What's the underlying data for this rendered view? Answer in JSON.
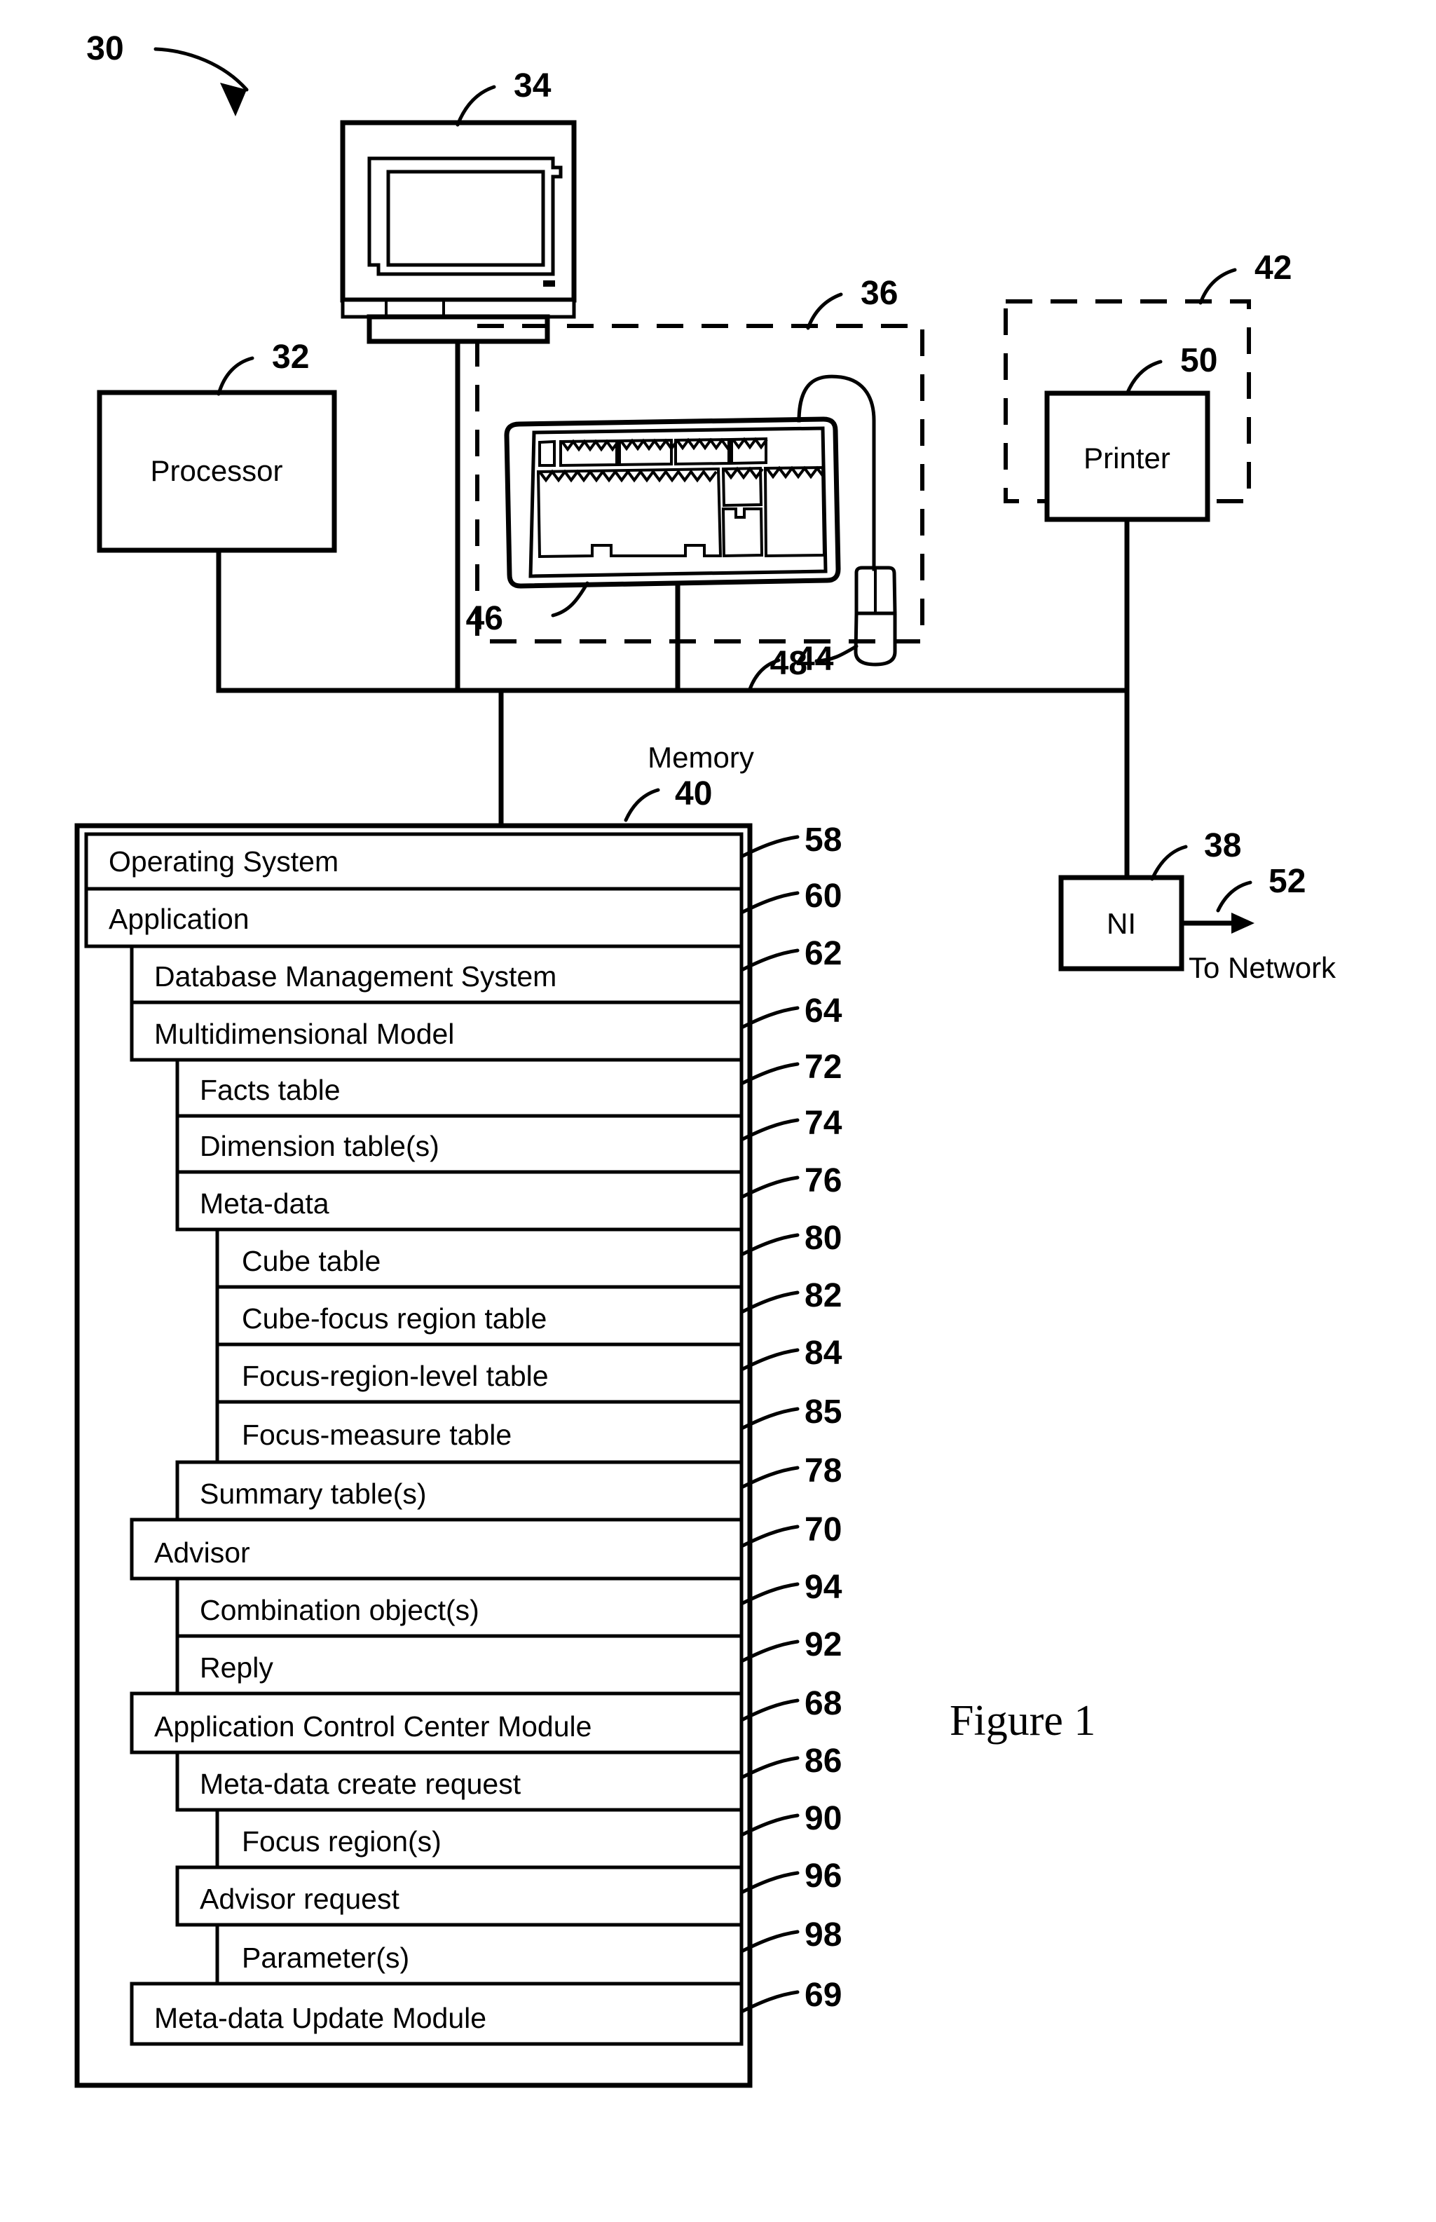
{
  "figure": {
    "caption": "Figure 1",
    "system_ref": "30"
  },
  "components": {
    "monitor": {
      "ref": "34",
      "name": "monitor"
    },
    "processor": {
      "label": "Processor",
      "ref": "32"
    },
    "io_group": {
      "ref": "36"
    },
    "keyboard": {
      "ref": "46",
      "name": "keyboard"
    },
    "mouse": {
      "ref": "48",
      "name": "mouse"
    },
    "printer_group": {
      "ref": "42"
    },
    "printer": {
      "label": "Printer",
      "ref": "50"
    },
    "network_interface": {
      "label": "NI",
      "ref": "38"
    },
    "network_arrow": {
      "label": "To Network",
      "ref": "52"
    },
    "bus": {
      "ref": "44"
    },
    "memory": {
      "label": "Memory",
      "ref": "40"
    }
  },
  "memory_rows": [
    {
      "label": "Operating System",
      "ref": "58",
      "indent": 0
    },
    {
      "label": "Application",
      "ref": "60",
      "indent": 0
    },
    {
      "label": "Database Management System",
      "ref": "62",
      "indent": 1
    },
    {
      "label": "Multidimensional Model",
      "ref": "64",
      "indent": 1
    },
    {
      "label": "Facts table",
      "ref": "72",
      "indent": 2
    },
    {
      "label": "Dimension table(s)",
      "ref": "74",
      "indent": 2
    },
    {
      "label": "Meta-data",
      "ref": "76",
      "indent": 2
    },
    {
      "label": "Cube table",
      "ref": "80",
      "indent": 3
    },
    {
      "label": "Cube-focus region table",
      "ref": "82",
      "indent": 3
    },
    {
      "label": "Focus-region-level table",
      "ref": "84",
      "indent": 3
    },
    {
      "label": "Focus-measure table",
      "ref": "85",
      "indent": 3
    },
    {
      "label": "Summary table(s)",
      "ref": "78",
      "indent": 2
    },
    {
      "label": "Advisor",
      "ref": "70",
      "indent": 1
    },
    {
      "label": "Combination object(s)",
      "ref": "94",
      "indent": 2
    },
    {
      "label": "Reply",
      "ref": "92",
      "indent": 2
    },
    {
      "label": "Application Control Center Module",
      "ref": "68",
      "indent": 1
    },
    {
      "label": "Meta-data create request",
      "ref": "86",
      "indent": 2
    },
    {
      "label": "Focus region(s)",
      "ref": "90",
      "indent": 3
    },
    {
      "label": "Advisor request",
      "ref": "96",
      "indent": 2
    },
    {
      "label": "Parameter(s)",
      "ref": "98",
      "indent": 3
    },
    {
      "label": "Meta-data Update Module",
      "ref": "69",
      "indent": 1
    }
  ],
  "colors": {
    "ink": "#000000",
    "paper": "#ffffff"
  }
}
